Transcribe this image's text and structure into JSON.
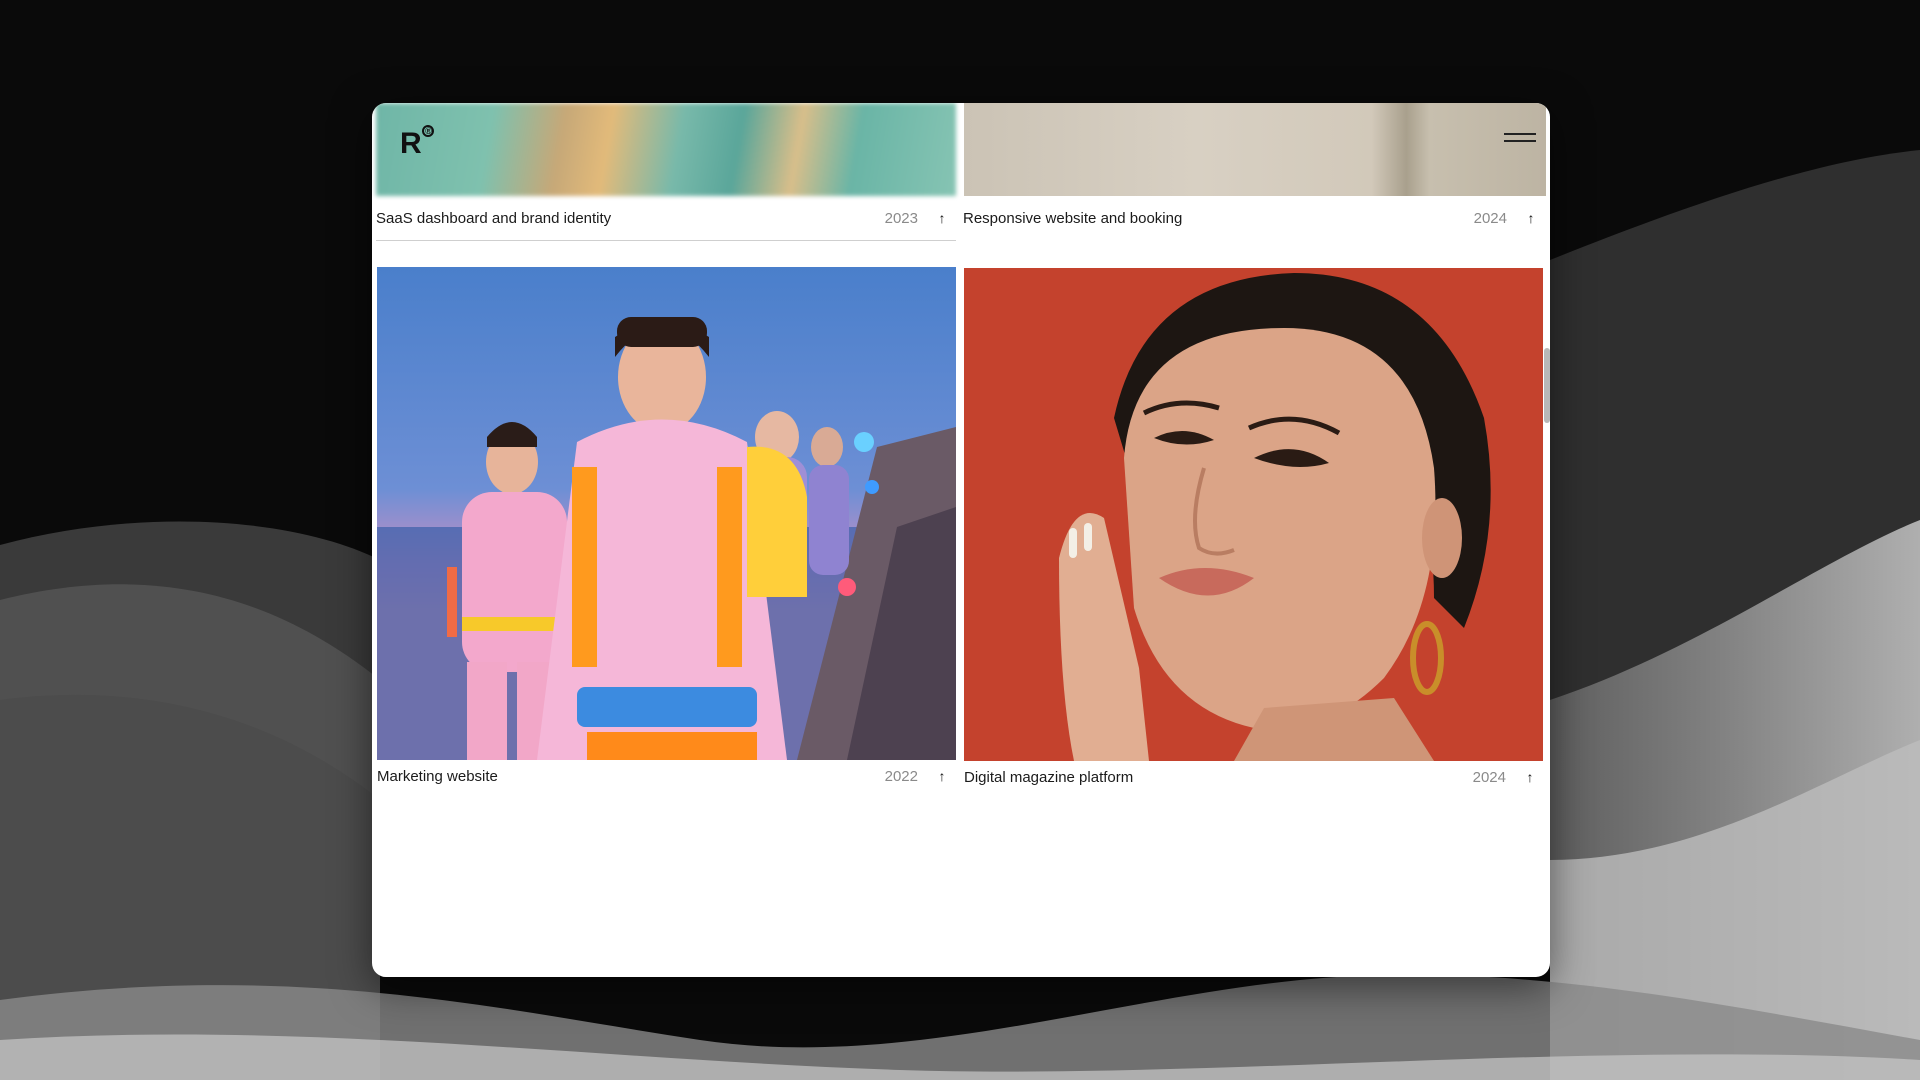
{
  "window": {
    "logo_text": "R",
    "logo_mark": "®",
    "menu_icon": "hamburger-menu-icon"
  },
  "projects": [
    {
      "title": "SaaS dashboard and brand identity",
      "year": "2023",
      "arrow": "↑"
    },
    {
      "title": "Responsive website and booking",
      "year": "2024",
      "arrow": "↑"
    },
    {
      "title": "Marketing website",
      "year": "2022",
      "arrow": "↑"
    },
    {
      "title": "Digital magazine platform",
      "year": "2024",
      "arrow": "↑"
    }
  ],
  "colors": {
    "page_background": "#0b0b0b",
    "window_background": "#ffffff",
    "text": "#1b1b1b",
    "year_text": "#8a8a8a",
    "portrait_backdrop": "#c3402c"
  }
}
